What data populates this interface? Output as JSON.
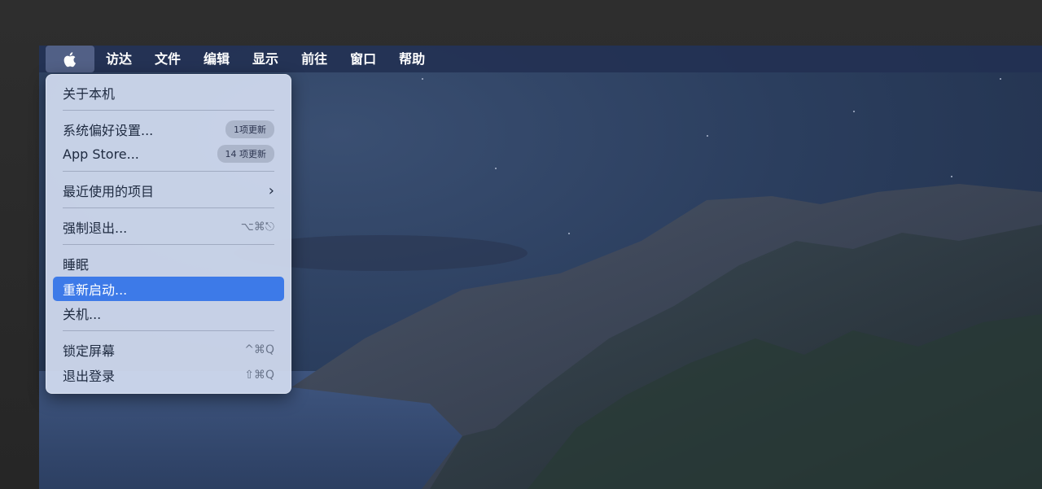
{
  "menubar": {
    "apple_icon": "apple-logo-icon",
    "menus": [
      "访达",
      "文件",
      "编辑",
      "显示",
      "前往",
      "窗口",
      "帮助"
    ]
  },
  "apple_menu": {
    "about": "关于本机",
    "system_prefs": {
      "label": "系统偏好设置...",
      "badge": "1项更新"
    },
    "app_store": {
      "label": "App Store...",
      "badge": "14 项更新"
    },
    "recent_items": {
      "label": "最近使用的项目",
      "icon": "chevron-right-icon"
    },
    "force_quit": {
      "label": "强制退出...",
      "shortcut": "⌥⌘⎋"
    },
    "sleep": "睡眠",
    "restart": "重新启动...",
    "shutdown": "关机...",
    "lock_screen": {
      "label": "锁定屏幕",
      "shortcut": "^⌘Q"
    },
    "logout": {
      "label": "退出登录",
      "shortcut": "⇧⌘Q"
    }
  },
  "colors": {
    "highlight": "#3d7ae8",
    "menubar_bg": "#223052",
    "menu_bg": "#d2dcf0"
  }
}
